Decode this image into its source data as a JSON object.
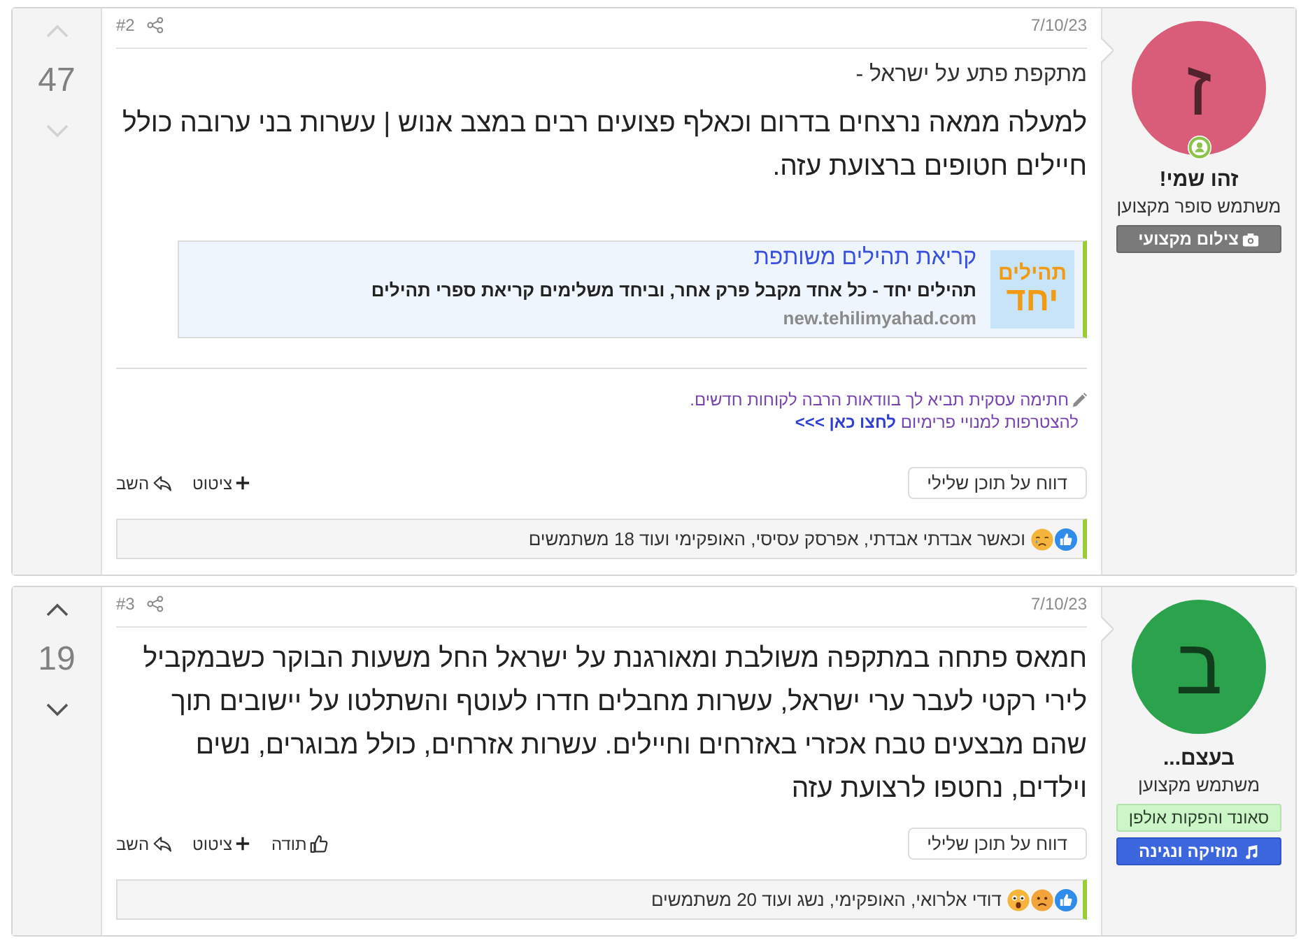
{
  "posts": [
    {
      "number": "#2",
      "date": "7/10/23",
      "vote": {
        "count": "47",
        "disabled": true
      },
      "author": {
        "initial": "ז",
        "color": "#d95c78",
        "online": true,
        "name": "זהו שמי!",
        "title": "משתמש סופר מקצוען",
        "banners": [
          {
            "kind": "photography",
            "label": "צילום מקצועי"
          }
        ]
      },
      "body": [
        {
          "kind": "lead",
          "text": "מתקפת פתע על ישראל -"
        },
        {
          "kind": "headline",
          "text": "למעלה ממאה נרצחים בדרום וכאלף פצועים רבים במצב אנוש | עשרות בני ערובה כולל חיילים חטופים ברצועת עזה."
        }
      ],
      "link_preview": {
        "logo_top": "תהילים",
        "logo_bottom": "יחד",
        "title": "קריאת תהילים משותפת",
        "description": "תהילים יחד - כל אחד מקבל פרק אחר, וביחד משלימים קריאת ספרי תהילים",
        "url": "new.tehilimyahad.com"
      },
      "signature": {
        "text": "חתימה עסקית תביא לך בוודאות הרבה לקוחות חדשים.",
        "cta": "להצטרפות למנויי פרימיום",
        "link": "לחצו כאן >>>"
      },
      "report_label": "דווח על תוכן שלילי",
      "actions": [
        {
          "kind": "quote",
          "label": "ציטוט"
        },
        {
          "kind": "reply",
          "label": "השב"
        }
      ],
      "reactions": {
        "emojis": [
          {
            "kind": "like"
          },
          {
            "kind": "cry"
          }
        ],
        "text": "וכאשר אבדתי אבדתי, אפרסק עסיסי, האופקימי ועוד 18 משתמשים"
      }
    },
    {
      "number": "#3",
      "date": "7/10/23",
      "vote": {
        "count": "19",
        "disabled": false
      },
      "author": {
        "initial": "ב",
        "color": "#2ba24c",
        "online": false,
        "name": "בעצם...",
        "title": "משתמש מקצוען",
        "banners": [
          {
            "kind": "studio",
            "label": "סאונד והפקות אולפן"
          },
          {
            "kind": "music",
            "label": "מוזיקה ונגינה"
          }
        ]
      },
      "body": [
        {
          "kind": "headline",
          "text": "חמאס פתחה במתקפה משולבת ומאורגנת על ישראל החל משעות הבוקר כשבמקביל לירי רקטי לעבר ערי ישראל, עשרות מחבלים חדרו לעוטף והשתלטו על יישובים תוך שהם מבצעים טבח אכזרי באזרחים וחיילים. עשרות אזרחים, כולל מבוגרים, נשים וילדים, נחטפו לרצועת עזה"
        }
      ],
      "report_label": "דווח על תוכן שלילי",
      "actions": [
        {
          "kind": "thanks",
          "label": "תודה"
        },
        {
          "kind": "quote",
          "label": "ציטוט"
        },
        {
          "kind": "reply",
          "label": "השב"
        }
      ],
      "reactions": {
        "emojis": [
          {
            "kind": "like"
          },
          {
            "kind": "sad"
          },
          {
            "kind": "wow"
          }
        ],
        "text": "דודי אלרואי, האופקימי, נשג ועוד 20 משתמשים"
      }
    }
  ]
}
